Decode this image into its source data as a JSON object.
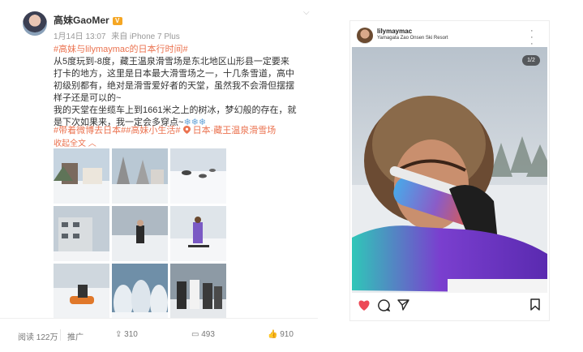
{
  "weibo": {
    "username": "高妹GaoMer",
    "vip_badge": "V",
    "meta": {
      "date": "1月14日 13:07",
      "source": "来自 iPhone 7 Plus"
    },
    "text": {
      "mention": "#高妹与lilymaymac的日本行时间#",
      "body1": "从5度玩到-8度，藏王温泉滑雪场是东北地区山形县一定要来打卡的地方，这里是日本最大滑雪场之一，十几条雪道，高中初级别都有，绝对是滑雪爱好者的天堂，虽然我不会滑但摆摆样子还是可以的~",
      "body2": "我的天堂在坐缆车上到1661米之上的树冰，梦幻般的存在，就是下次如果来，我一定会多穿点~",
      "snowflakes": "❄❄❄"
    },
    "tags": {
      "tag1": "#带着微博去日本#",
      "tag2": "#高妹小生活#",
      "location": "日本·藏王温泉滑雪场"
    },
    "collapse": "收起全文",
    "footer": {
      "reads": "阅读 122万",
      "promote": "推广",
      "reposts": "310",
      "comments": "493",
      "likes": "910"
    }
  },
  "instagram": {
    "username": "lilymaymac",
    "location": "Yamagata Zao Onsen Ski Resort",
    "counter": "1/2"
  },
  "colors": {
    "weibo_link": "#eb7350",
    "weibo_emoji": "#6aa5d8",
    "ig_like": "#ed4956"
  }
}
